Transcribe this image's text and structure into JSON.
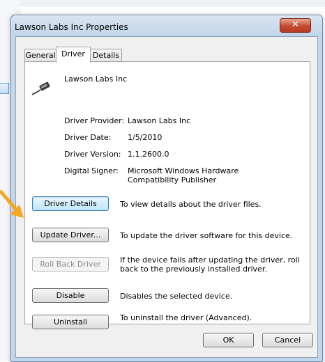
{
  "window": {
    "title": "Lawson Labs Inc Properties",
    "close_glyph": "✕"
  },
  "tabs": [
    {
      "label": "General",
      "active": false
    },
    {
      "label": "Driver",
      "active": true
    },
    {
      "label": "Details",
      "active": false
    }
  ],
  "device": {
    "name": "Lawson Labs Inc",
    "icon": "usb-cable-icon"
  },
  "driver_info": [
    {
      "label": "Driver Provider:",
      "value": "Lawson Labs Inc"
    },
    {
      "label": "Driver Date:",
      "value": "1/5/2010"
    },
    {
      "label": "Driver Version:",
      "value": "1.1.2600.0"
    },
    {
      "label": "Digital Signer:",
      "value": "Microsoft Windows Hardware Compatibility Publisher"
    }
  ],
  "actions": [
    {
      "label": "Driver Details",
      "description": "To view details about the driver files."
    },
    {
      "label": "Update Driver...",
      "description": "To update the driver software for this device."
    },
    {
      "label": "Roll Back Driver",
      "description": "If the device fails after updating the driver, roll back to the previously installed driver."
    },
    {
      "label": "Disable",
      "description": "Disables the selected device."
    },
    {
      "label": "Uninstall",
      "description": "To uninstall the driver (Advanced)."
    }
  ],
  "footer": {
    "ok_label": "OK",
    "cancel_label": "Cancel"
  },
  "colors": {
    "arrow": "#f5a623",
    "titlebar": "#c4d6ea",
    "close_button": "#c44b32"
  }
}
